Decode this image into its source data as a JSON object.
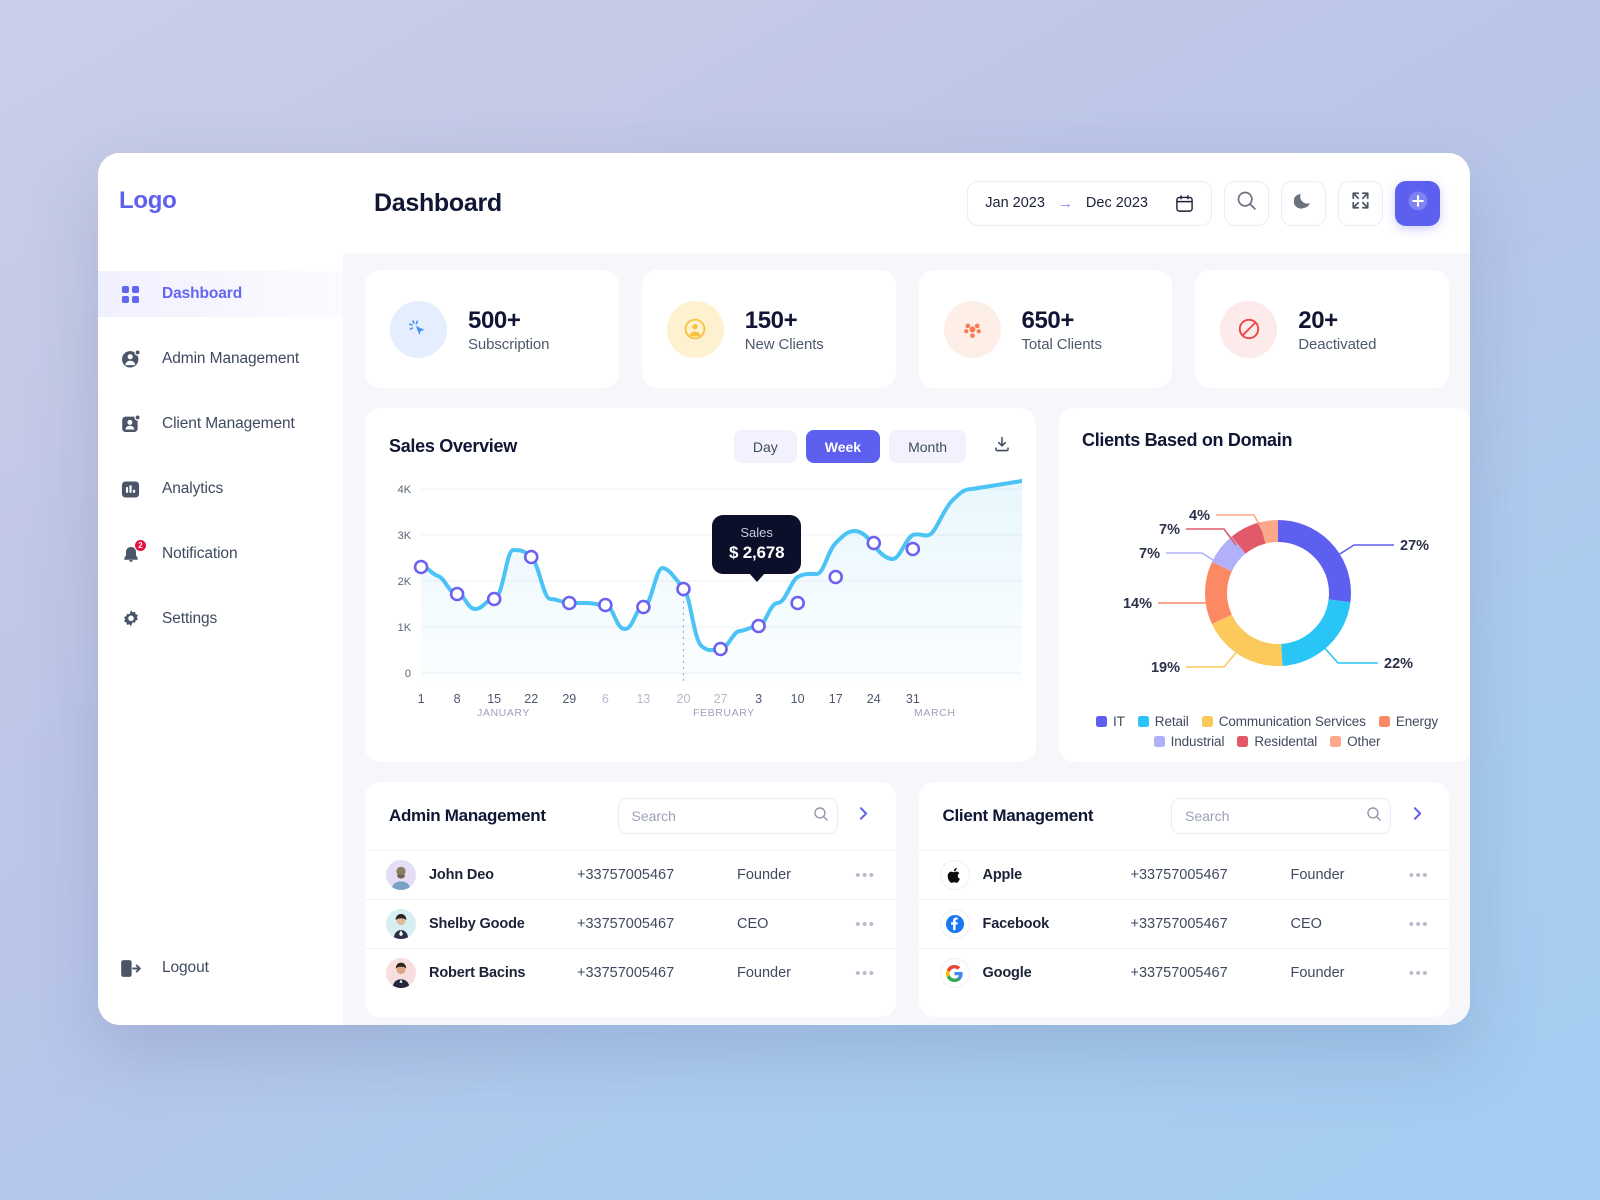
{
  "brand": {
    "logo": "Logo",
    "accent": "#5d5fef"
  },
  "sidebar": {
    "items": [
      {
        "label": "Dashboard",
        "icon": "grid-icon",
        "active": true
      },
      {
        "label": "Admin Management",
        "icon": "admin-user-icon",
        "active": false
      },
      {
        "label": "Client Management",
        "icon": "client-user-icon",
        "active": false
      },
      {
        "label": "Analytics",
        "icon": "bar-chart-icon",
        "active": false
      },
      {
        "label": "Notification",
        "icon": "bell-icon",
        "active": false,
        "badge": "2"
      },
      {
        "label": "Settings",
        "icon": "gear-icon",
        "active": false
      }
    ],
    "logout": {
      "label": "Logout",
      "icon": "logout-icon"
    }
  },
  "header": {
    "title": "Dashboard",
    "date_range": {
      "start": "Jan 2023",
      "arrow": "→",
      "end": "Dec 2023",
      "icon": "calendar-icon"
    },
    "actions": [
      {
        "name": "search-icon"
      },
      {
        "name": "moon-icon"
      },
      {
        "name": "fullscreen-icon"
      },
      {
        "name": "add-plus-icon"
      }
    ]
  },
  "stats": [
    {
      "value": "500+",
      "label": "Subscription",
      "icon": "cursor-click-icon",
      "icon_bg": "#e4eefe",
      "icon_color": "#4c8ff5"
    },
    {
      "value": "150+",
      "label": "New Clients",
      "icon": "user-circle-icon",
      "icon_bg": "#fdf1cf",
      "icon_color": "#f8c23c"
    },
    {
      "value": "650+",
      "label": "Total Clients",
      "icon": "users-group-icon",
      "icon_bg": "#fdeee7",
      "icon_color": "#f97b56"
    },
    {
      "value": "20+",
      "label": "Deactivated",
      "icon": "ban-icon",
      "icon_bg": "#fdeaea",
      "icon_color": "#ef4444"
    }
  ],
  "sales": {
    "title": "Sales Overview",
    "tabs": [
      {
        "label": "Day",
        "active": false
      },
      {
        "label": "Week",
        "active": true
      },
      {
        "label": "Month",
        "active": false
      }
    ],
    "download_icon": "download-icon",
    "tooltip": {
      "label": "Sales",
      "value": "$ 2,678"
    }
  },
  "domain": {
    "title": "Clients Based on Domain"
  },
  "admin_table": {
    "title": "Admin Management",
    "search_placeholder": "Search",
    "search_value": "",
    "rows": [
      {
        "name": "John Deo",
        "phone": "+33757005467",
        "role": "Founder",
        "avatar": "av-1"
      },
      {
        "name": "Shelby Goode",
        "phone": "+33757005467",
        "role": "CEO",
        "avatar": "av-2"
      },
      {
        "name": "Robert Bacins",
        "phone": "+33757005467",
        "role": "Founder",
        "avatar": "av-3"
      }
    ]
  },
  "client_table": {
    "title": "Client Management",
    "search_placeholder": "Search",
    "search_value": "",
    "rows": [
      {
        "name": "Apple",
        "phone": "+33757005467",
        "role": "Founder",
        "icon": "apple-logo-icon"
      },
      {
        "name": "Facebook",
        "phone": "+33757005467",
        "role": "CEO",
        "icon": "facebook-logo-icon"
      },
      {
        "name": "Google",
        "phone": "+33757005467",
        "role": "Founder",
        "icon": "google-logo-icon"
      }
    ]
  },
  "chart_data": [
    {
      "type": "line",
      "title": "Sales Overview",
      "xlabel": "",
      "ylabel": "",
      "ylim": [
        0,
        4000
      ],
      "yticks": [
        0,
        1000,
        2000,
        3000,
        4000
      ],
      "ytick_labels": [
        "0",
        "1K",
        "2K",
        "3K",
        "4K"
      ],
      "grid": true,
      "legend": "none",
      "series_color": "#4cc3f5",
      "marker_color": "#6d62f0",
      "x": [
        "1",
        "8",
        "15",
        "22",
        "29",
        "6",
        "13",
        "20",
        "27",
        "3",
        "10",
        "17",
        "24",
        "31"
      ],
      "month_groups": [
        {
          "label": "JANUARY",
          "ticks": [
            "1",
            "8",
            "15",
            "22",
            "29"
          ]
        },
        {
          "label": "FEBRUARY",
          "ticks": [
            "6",
            "13",
            "20",
            "27"
          ]
        },
        {
          "label": "MARCH",
          "ticks": [
            "3",
            "10",
            "17",
            "24",
            "31"
          ]
        }
      ],
      "values": [
        2300,
        1720,
        1620,
        2670,
        1600,
        1530,
        1450,
        2000,
        610,
        990,
        1550,
        2220,
        3050,
        2900
      ],
      "highlight": {
        "x": "20",
        "value": 2678,
        "label": "Sales",
        "display": "$ 2,678"
      }
    },
    {
      "type": "pie",
      "title": "Clients Based on Domain",
      "labels": [
        "IT",
        "Retail",
        "Communication Services",
        "Energy",
        "Industrial",
        "Residental",
        "Other"
      ],
      "values": [
        27,
        22,
        19,
        14,
        7,
        7,
        4
      ],
      "value_labels": [
        "27%",
        "22%",
        "19%",
        "14%",
        "7%",
        "7%",
        "4%"
      ],
      "colors": [
        "#5d5fef",
        "#29c5f6",
        "#fbc95c",
        "#fb8a64",
        "#b3b0fb",
        "#e2596a",
        "#fda989"
      ],
      "legend": "bottom",
      "donut": true
    }
  ]
}
